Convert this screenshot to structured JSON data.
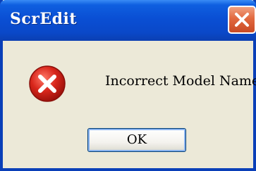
{
  "dialog": {
    "title": "ScrEdit",
    "message": "Incorrect Model Name",
    "ok_label": "OK",
    "icon": "error-icon",
    "colors": {
      "titlebar": "#0a4fd4",
      "close": "#e2693f",
      "error_red": "#d8261b",
      "background": "#ece9d8"
    }
  }
}
